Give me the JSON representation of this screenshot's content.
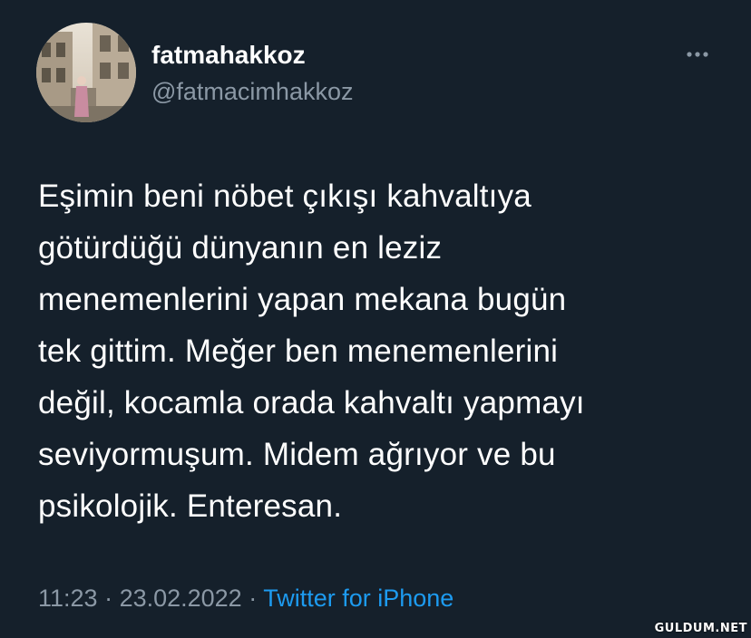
{
  "author": {
    "display_name": "fatmahakkoz",
    "username": "@fatmacimhakkoz",
    "avatar_icon": "profile-photo"
  },
  "more_icon": "more-horizontal-icon",
  "tweet": {
    "lines": [
      "Eşimin beni nöbet çıkışı kahvaltıya",
      "götürdüğü dünyanın en leziz",
      "menemenlerini yapan mekana bugün",
      "tek gittim. Meğer ben menemenlerini",
      "değil, kocamla orada kahvaltı yapmayı",
      "seviyormuşum. Midem ağrıyor ve bu",
      "psikolojik. Enteresan."
    ]
  },
  "meta": {
    "time": "11:23",
    "separator": " · ",
    "date": "23.02.2022",
    "source": "Twitter for iPhone"
  },
  "watermark": "GULDUM.NET",
  "colors": {
    "background": "#15202b",
    "text": "#ffffff",
    "secondary": "#8b98a5",
    "link": "#1d9bf0"
  }
}
